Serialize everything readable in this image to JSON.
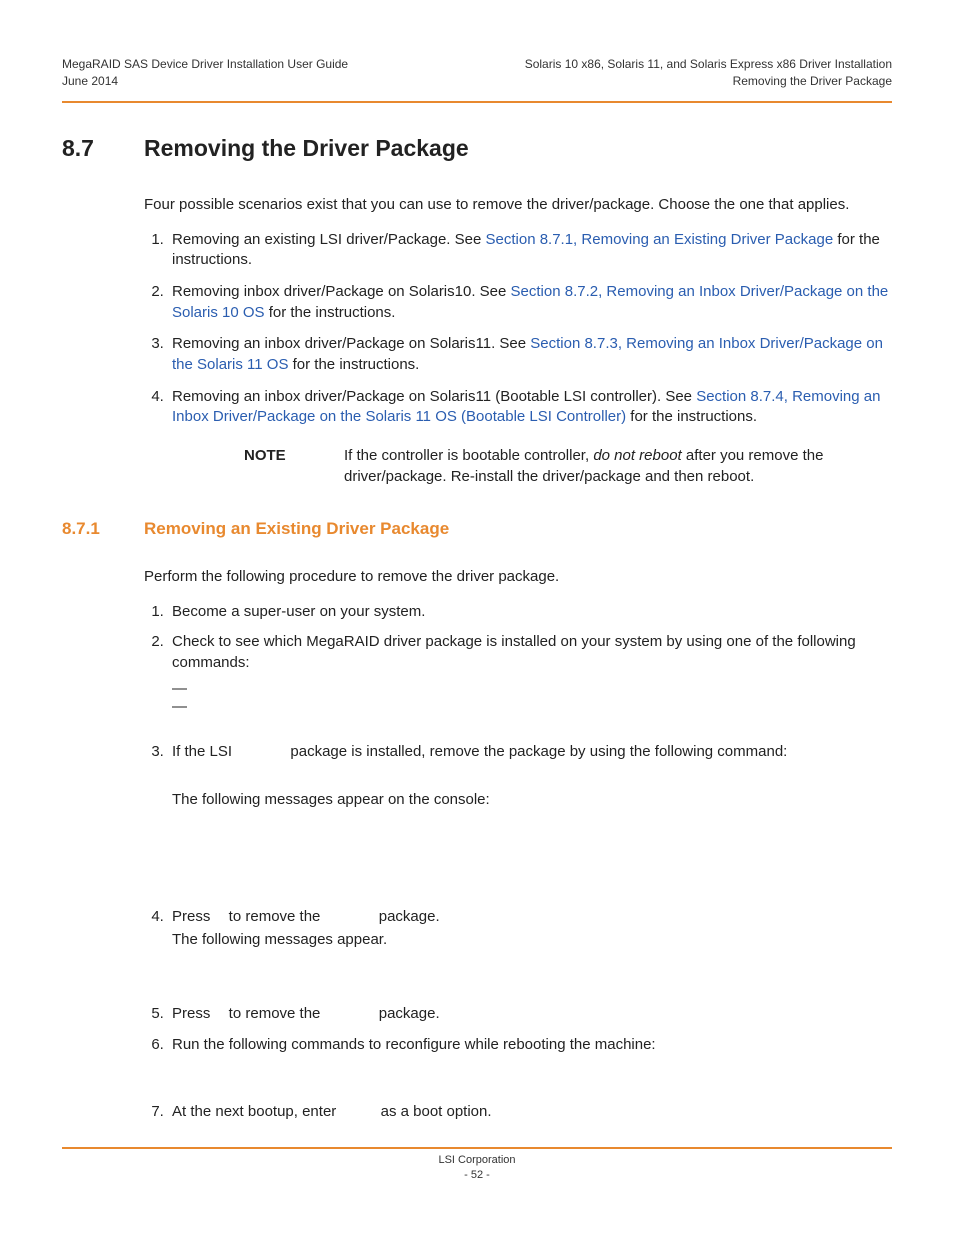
{
  "header": {
    "left_line1": "MegaRAID SAS Device Driver Installation User Guide",
    "left_line2": "June 2014",
    "right_line1": "Solaris 10 x86, Solaris 11, and Solaris Express x86 Driver Installation",
    "right_line2": "Removing the Driver Package"
  },
  "section": {
    "num": "8.7",
    "title": "Removing the Driver Package",
    "intro": "Four possible scenarios exist that you can use to remove the driver/package. Choose the one that applies.",
    "items": [
      {
        "pre": "Removing an existing LSI driver/Package. See ",
        "link": "Section 8.7.1, Removing an Existing Driver Package",
        "post": " for the instructions."
      },
      {
        "pre": "Removing inbox driver/Package on Solaris10. See ",
        "link": "Section 8.7.2, Removing an Inbox Driver/Package on the Solaris 10 OS",
        "post": " for the instructions."
      },
      {
        "pre": "Removing an inbox driver/Package on Solaris11. See ",
        "link": "Section 8.7.3, Removing an Inbox Driver/Package on the Solaris 11 OS",
        "post": " for the instructions."
      },
      {
        "pre": "Removing an inbox driver/Package on Solaris11 (Bootable LSI controller). See ",
        "link": "Section 8.7.4, Removing an Inbox Driver/Package on the Solaris 11 OS (Bootable LSI Controller)",
        "post": " for the instructions."
      }
    ],
    "note_label": "NOTE",
    "note_pre": "If the controller is bootable controller, ",
    "note_em": "do not reboot",
    "note_post": " after you remove the driver/package. Re-install the driver/package and then reboot."
  },
  "subsection": {
    "num": "8.7.1",
    "title": "Removing an Existing Driver Package",
    "intro": "Perform the following procedure to remove the driver package.",
    "steps": {
      "s1": "Become a super-user on your system.",
      "s2": "Check to see which MegaRAID driver package is installed on your system by using one of the following commands:",
      "s2_dash1": "—",
      "s2_dash2": "—",
      "s3_a": "If the LSI ",
      "s3_b": " package is installed, remove the package by using the following command:",
      "s3_msg": "The following messages appear on the console:",
      "s4_a": "Press ",
      "s4_b": " to remove the ",
      "s4_c": " package.",
      "s4_msg": "The following messages appear.",
      "s5_a": "Press ",
      "s5_b": " to remove the ",
      "s5_c": " package.",
      "s6": "Run the following commands to reconfigure while rebooting the machine:",
      "s7_a": "At the next bootup, enter ",
      "s7_b": " as a boot option."
    }
  },
  "footer": {
    "line1": "LSI Corporation",
    "line2": "- 52 -"
  }
}
